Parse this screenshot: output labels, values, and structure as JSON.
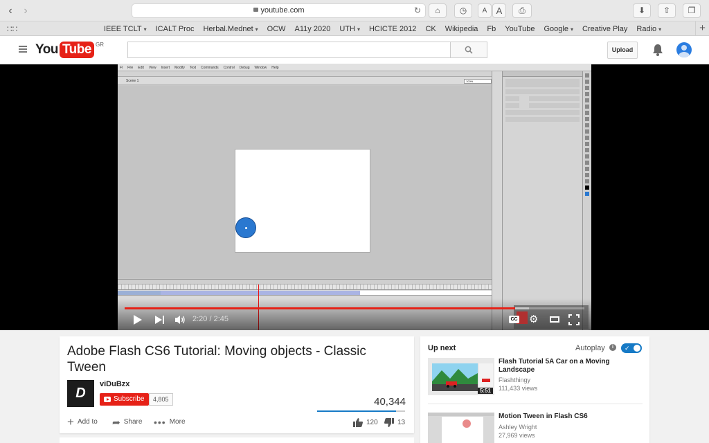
{
  "browser": {
    "url": "youtube.com",
    "back_icon": "chevron-left-icon",
    "forward_icon": "chevron-right-icon",
    "font_small": "A",
    "font_large": "A"
  },
  "bookmarks": [
    {
      "label": "IEEE TCLT",
      "has_menu": true
    },
    {
      "label": "ICALT Proc",
      "has_menu": false
    },
    {
      "label": "Herbal.Mednet",
      "has_menu": true
    },
    {
      "label": "OCW",
      "has_menu": false
    },
    {
      "label": "A11y 2020",
      "has_menu": false
    },
    {
      "label": "UTH",
      "has_menu": true
    },
    {
      "label": "HCICTE 2012",
      "has_menu": false
    },
    {
      "label": "CK",
      "has_menu": false
    },
    {
      "label": "Wikipedia",
      "has_menu": false
    },
    {
      "label": "Fb",
      "has_menu": false
    },
    {
      "label": "YouTube",
      "has_menu": false
    },
    {
      "label": "Google",
      "has_menu": true
    },
    {
      "label": "Creative Play",
      "has_menu": false
    },
    {
      "label": "Radio",
      "has_menu": true
    }
  ],
  "masthead": {
    "logo_you": "You",
    "logo_tube": "Tube",
    "region": "GR",
    "search_placeholder": "",
    "upload_label": "Upload"
  },
  "player": {
    "time": "2:20 / 2:45",
    "played_fraction": 0.85,
    "loaded_fraction": 0.88,
    "cc_label": "CC",
    "flash": {
      "menu": [
        "Fl",
        "File",
        "Edit",
        "View",
        "Insert",
        "Modify",
        "Text",
        "Commands",
        "Control",
        "Debug",
        "Window",
        "Help"
      ],
      "scene": "Scene 1",
      "zoom": "100%"
    }
  },
  "video": {
    "title": "Adobe Flash CS6 Tutorial: Moving objects - Classic Tween",
    "channel": "viDuBzx",
    "channel_avatar_text": "D",
    "subscribe_label": "Subscribe",
    "subscriber_count": "4,805",
    "views": "40,344",
    "like_fraction": 0.9,
    "likes": "120",
    "dislikes": "13",
    "add_to_label": "Add to",
    "share_label": "Share",
    "more_label": "More"
  },
  "sidebar": {
    "up_next_label": "Up next",
    "autoplay_label": "Autoplay",
    "autoplay_on": true,
    "recommendations": [
      {
        "title": "Flash Tutorial 5A Car on a Moving Landscape",
        "channel": "Flashthingy",
        "views": "111,433 views",
        "duration": "5:51"
      },
      {
        "title": "Motion Tween in Flash CS6",
        "channel": "Ashley Wright",
        "views": "27,969 views",
        "duration": ""
      }
    ]
  },
  "colors": {
    "brand_red": "#e62117",
    "accent_blue": "#167ac6"
  }
}
